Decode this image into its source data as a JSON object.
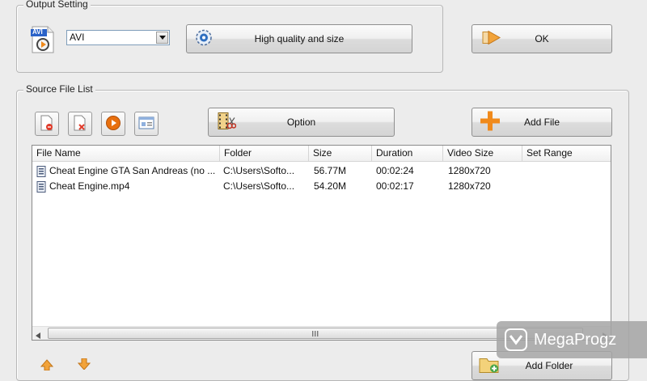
{
  "output_setting": {
    "title": "Output Setting",
    "format_value": "AVI",
    "format_icon_text": "AVI",
    "quality_button": "High quality and size",
    "ok_button": "OK"
  },
  "source_list": {
    "title": "Source File List",
    "option_button": "Option",
    "add_file_button": "Add File",
    "add_folder_button": "Add Folder",
    "columns": [
      "File Name",
      "Folder",
      "Size",
      "Duration",
      "Video Size",
      "Set Range"
    ],
    "rows": [
      {
        "file_name": "Cheat Engine GTA San Andreas (no ...",
        "folder": "C:\\Users\\Softo...",
        "size": "56.77M",
        "duration": "00:02:24",
        "video_size": "1280x720",
        "set_range": ""
      },
      {
        "file_name": "Cheat Engine.mp4",
        "folder": "C:\\Users\\Softo...",
        "size": "54.20M",
        "duration": "00:02:17",
        "video_size": "1280x720",
        "set_range": ""
      }
    ]
  },
  "watermark": {
    "text": "MegaProgz"
  },
  "icons": {
    "remove": "document-remove-icon",
    "delete": "document-delete-icon",
    "play": "play-icon",
    "properties": "properties-icon",
    "option": "film-scissors-icon",
    "add": "plus-icon",
    "ok": "arrow-right-icon",
    "quality": "quality-gear-icon"
  },
  "colors": {
    "accent_orange": "#f08a1c",
    "play_orange": "#e8700f",
    "list_border": "#8a8a8a"
  }
}
